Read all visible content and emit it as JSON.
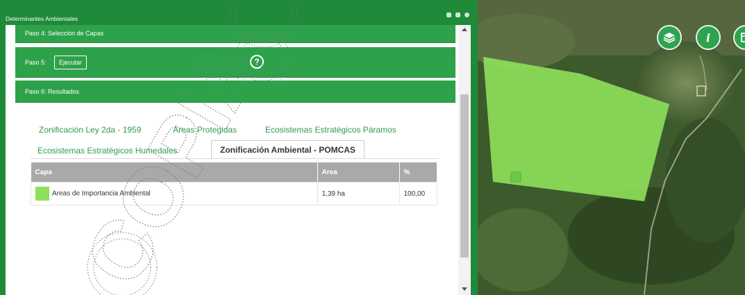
{
  "panel": {
    "title": "Determinantes Ambientales",
    "steps": {
      "step4_label": "Paso 4: Selección de Capas",
      "step5_label": "Paso 5:",
      "step5_button": "Ejecutar",
      "step5_help_glyph": "?",
      "step6_label": "Paso 6: Resultados"
    },
    "tabs": [
      {
        "label": "Zonificación Ley 2da - 1959"
      },
      {
        "label": "Áreas Protegidas"
      },
      {
        "label": "Ecosistemas Estratégicos Páramos"
      },
      {
        "label": "Ecosistemas Estratégicos Humedales"
      },
      {
        "label": "Zonificación Ambiental - POMCAS"
      }
    ],
    "active_tab_index": 4,
    "table": {
      "headers": {
        "capa": "Capa",
        "area": "Area",
        "percent": "%"
      },
      "rows": [
        {
          "capa": "Areas de Importancia Ambiental",
          "area": "1,39 ha",
          "percent": "100,00",
          "swatch_color": "#8ee05a"
        }
      ]
    }
  },
  "watermark_text": "COPIA",
  "map": {
    "buttons": [
      {
        "icon": "layers-icon"
      },
      {
        "icon": "info-icon",
        "glyph": "i"
      },
      {
        "icon": "table-icon"
      }
    ],
    "polygon_color": "#8ee05a"
  },
  "colors": {
    "panel_green": "#1e8a3a",
    "step_green": "#2da24a",
    "tab_green": "#2e9c4a",
    "table_header": "#a9a9a9"
  }
}
